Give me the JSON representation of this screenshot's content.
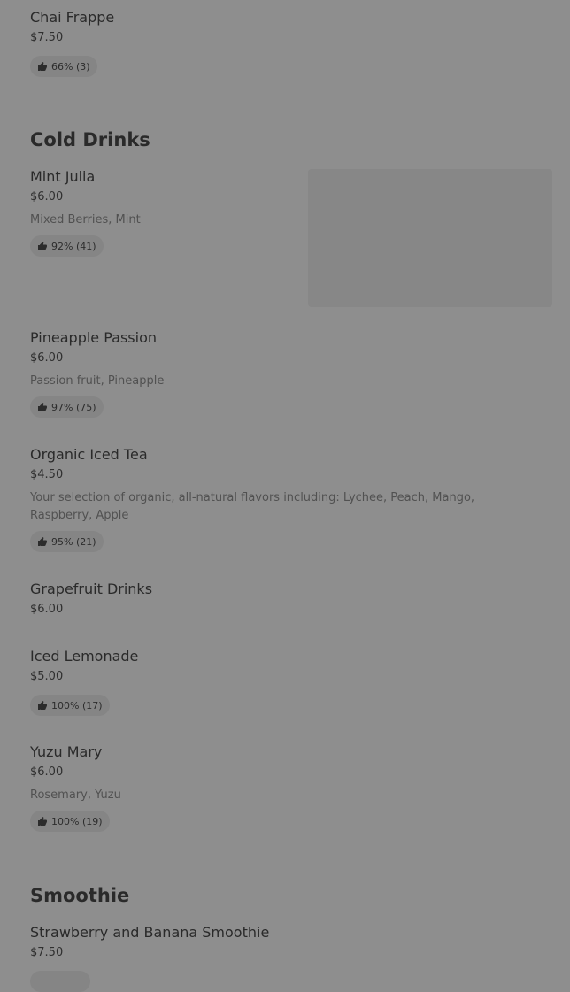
{
  "sections": [
    {
      "title": "",
      "items": [
        {
          "name": "Chai Frappe",
          "price": "$7.50",
          "description": "",
          "rating": "66% (3)"
        }
      ]
    },
    {
      "title": "Cold Drinks",
      "items": [
        {
          "name": "Mint Julia",
          "price": "$6.00",
          "description": "Mixed Berries, Mint",
          "rating": "92% (41)"
        },
        {
          "name": "Pineapple Passion",
          "price": "$6.00",
          "description": "Passion fruit, Pineapple",
          "rating": "97% (75)"
        },
        {
          "name": "Organic Iced Tea",
          "price": "$4.50",
          "description": "Your selection of organic, all-natural flavors including: Lychee, Peach, Mango, Raspberry, Apple",
          "rating": "95% (21)"
        },
        {
          "name": "Grapefruit Drinks",
          "price": "$6.00",
          "description": "",
          "rating": ""
        },
        {
          "name": "Iced Lemonade",
          "price": "$5.00",
          "description": "",
          "rating": "100% (17)"
        },
        {
          "name": "Yuzu Mary",
          "price": "$6.00",
          "description": "Rosemary, Yuzu",
          "rating": "100% (19)"
        }
      ]
    },
    {
      "title": "Smoothie",
      "items": [
        {
          "name": "Strawberry and Banana Smoothie",
          "price": "$7.50",
          "description": "",
          "rating": ""
        }
      ]
    }
  ],
  "icons": {
    "rating": "thumbs-up-icon",
    "image_placeholder": "item-image-placeholder"
  },
  "colors": {
    "overlay": "#8e8e8e",
    "pill": "#858585",
    "image_placeholder": "#878787"
  }
}
